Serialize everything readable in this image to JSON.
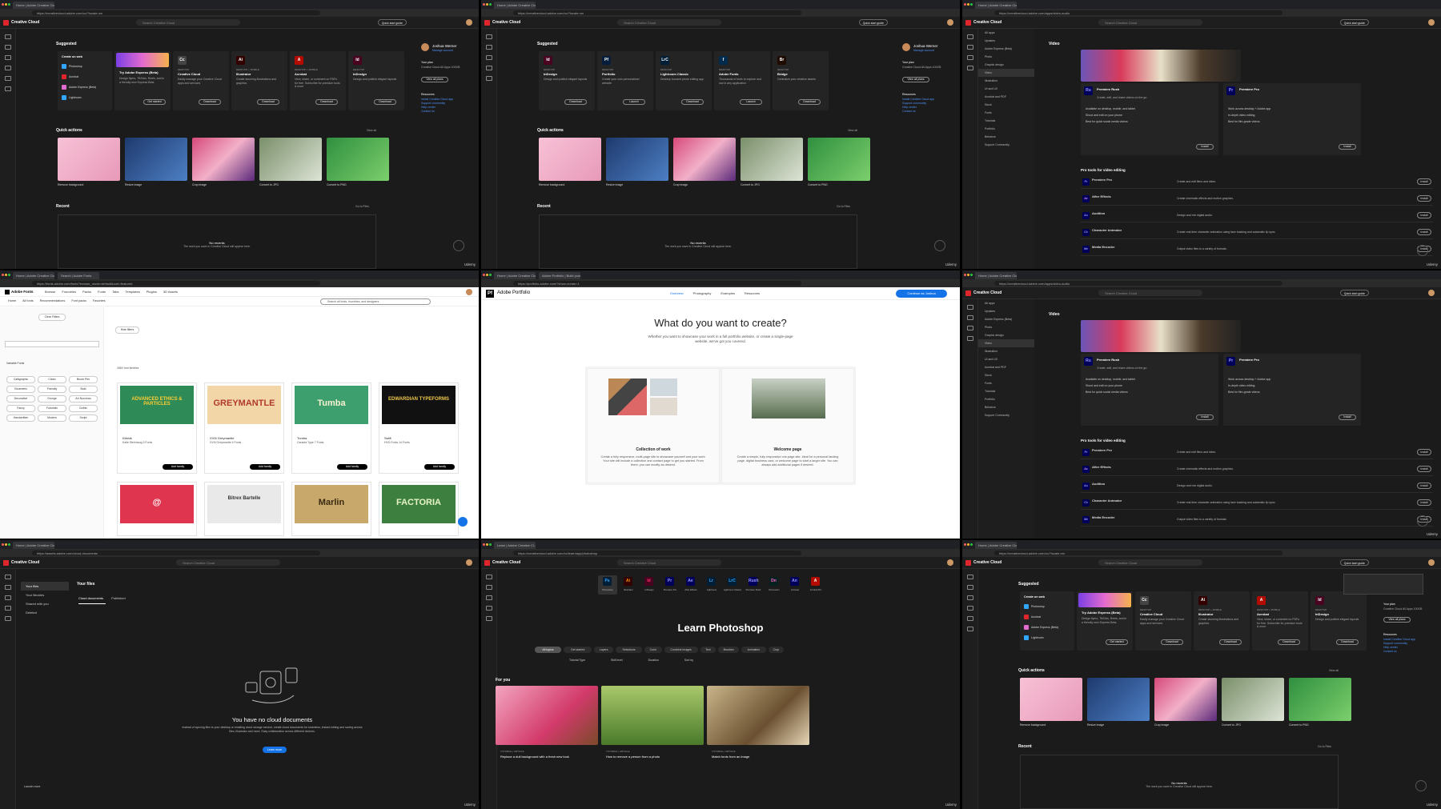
{
  "common": {
    "cc_title": "Creative Cloud",
    "search_placeholder": "Search Creative Cloud",
    "quick_start": "Quick start guide",
    "udemy": "Udemy",
    "tab_cc": "Home | Adobe Creative Cloud",
    "tab_fonts": "Search | Adobe Fonts",
    "tab_portfolio": "Adobe Portfolio | Build your",
    "tab_learn": "Learn | Adobe Creative Cl...",
    "url_home": "https://creativecloud.adobe.com/cc/?locale=en",
    "url_apps": "https://creativecloud.adobe.com/apps/video-audio",
    "url_fonts": "https://fonts.adobe.com/fonts?browse_mode=default&sort=featured",
    "url_portfolio": "https://portfolio.adobe.com/?show-create=1",
    "url_files": "https://assets.adobe.com/cloud-documents",
    "url_learn": "https://creativecloud.adobe.com/cc/learn/app/photoshop"
  },
  "home": {
    "suggested": "Suggested",
    "create_on_web": "Create on web",
    "web_items": [
      "Photoshop",
      "Acrobat",
      "Adobe Express (Beta)",
      "Lightroom"
    ],
    "express_title": "Try Adobe Express (Beta)",
    "express_desc": "Design flyers, TikToks, Reels, and in a friendly new Express Beta.",
    "get_started": "Get started",
    "apps": [
      {
        "tag": "DESKTOP",
        "name": "Creative Cloud",
        "desc": "Easily manage your Creative Cloud apps and services",
        "btn": "Download",
        "color": "#444",
        "abbr": "Cc"
      },
      {
        "tag": "DESKTOP + MOBILE",
        "name": "Illustrator",
        "desc": "Create stunning illustrations and graphics",
        "btn": "Download",
        "color": "#330000",
        "abbr": "Ai"
      },
      {
        "tag": "DESKTOP + MOBILE",
        "name": "Acrobat",
        "desc": "View, share, or comment on PDFs for free. Subscribe for premium tools & more",
        "btn": "Download",
        "color": "#b30b00",
        "abbr": "A"
      },
      {
        "tag": "DESKTOP",
        "name": "InDesign",
        "desc": "Design and publish elegant layouts",
        "btn": "Download",
        "color": "#49021f",
        "abbr": "Id"
      }
    ],
    "apps_b": [
      {
        "tag": "DESKTOP",
        "name": "InDesign",
        "desc": "Design and publish elegant layouts",
        "btn": "Download",
        "color": "#49021f",
        "abbr": "Id"
      },
      {
        "tag": "DESKTOP",
        "name": "Portfolio",
        "desc": "Create your own personalized website",
        "btn": "Launch",
        "color": "#061e3c",
        "abbr": "Pf"
      },
      {
        "tag": "DESKTOP",
        "name": "Lightroom Classic",
        "desc": "Desktop focused photo editing app",
        "btn": "Download",
        "color": "#001e36",
        "abbr": "LrC"
      },
      {
        "tag": "DESKTOP",
        "name": "Adobe Fonts",
        "desc": "Thousands of fonts to explore and use in any application",
        "btn": "Launch",
        "color": "#002b4d",
        "abbr": "f"
      },
      {
        "tag": "DESKTOP",
        "name": "Bridge",
        "desc": "Centralize your creative assets",
        "btn": "Download",
        "color": "#1f0b00",
        "abbr": "Br"
      }
    ],
    "user_name": "Joshua Werner",
    "manage_account": "Manage account",
    "your_plan": "Your plan",
    "plan_name": "Creative Cloud All Apps 100GB",
    "view_plans": "View all plans",
    "resources": "Resources",
    "resource_links": [
      "Install Creative Cloud app",
      "Support community",
      "Help center",
      "Contact us"
    ],
    "quick_actions": "Quick actions",
    "view_all": "View all",
    "actions": [
      "Remove background",
      "Resize image",
      "Crop image",
      "Convert to JPG",
      "Convert to PNG"
    ],
    "recent": "Recent",
    "go_to_files": "Go to Files",
    "no_recents": "No recents",
    "no_recents_desc": "The work you save in Creative Cloud will appear here."
  },
  "apps_page": {
    "heading": "Video",
    "sidebar": [
      "All apps",
      "Updates",
      "Adobe Express (Beta)",
      "Photo",
      "Graphic design",
      "Video",
      "Illustration",
      "UI and UX",
      "Acrobat and PDF",
      "Stock",
      "Fonts",
      "Tutorials",
      "Portfolio",
      "Behance",
      "Support Community"
    ],
    "rush_name": "Premiere Rush",
    "rush_desc": "Create, edit, and share videos on the go.",
    "rush_points": [
      "Available on desktop, mobile, and tablet",
      "Shoot and edit on your phone",
      "Best for quick social media videos"
    ],
    "pro_name": "Premiere Pro",
    "pro_points": [
      "Work across desktop + Adobe app",
      "In-depth video editing",
      "Best for film-grade videos"
    ],
    "install": "Install",
    "pro_tools": "Pro tools for video editing",
    "rows": [
      {
        "abbr": "Pr",
        "name": "Premiere Pro",
        "desc": "Create and edit films and video.",
        "color": "#00005b",
        "fg": "#9999ff"
      },
      {
        "abbr": "Ae",
        "name": "After Effects",
        "desc": "Create cinematic effects and motion graphics.",
        "color": "#00005b",
        "fg": "#d291ff"
      },
      {
        "abbr": "Au",
        "name": "Audition",
        "desc": "Design and mix digital audio.",
        "color": "#00005b",
        "fg": "#9999ff"
      },
      {
        "abbr": "Ch",
        "name": "Character Animator",
        "desc": "Create real-time character animation using face tracking and automatic lip sync.",
        "color": "#000050",
        "fg": "#9999ff"
      },
      {
        "abbr": "Me",
        "name": "Media Encoder",
        "desc": "Output video files to a variety of formats.",
        "color": "#00005b",
        "fg": "#9999ff"
      }
    ]
  },
  "fonts": {
    "brand": "Adobe Fonts",
    "nav": [
      "Browse",
      "Foundries",
      "Packs",
      "Fonts",
      "Tabs",
      "Templates",
      "Plugins",
      "3D Assets"
    ],
    "subnav": [
      "Home",
      "All fonts",
      "Recommendations",
      "Font packs",
      "Favorites"
    ],
    "search_placeholder": "Search all fonts, foundries, and designers",
    "clear_filters": "Clear Filters",
    "hide_filters": "Hide filters",
    "count": "2860 font families",
    "tags": [
      "Calligraphic",
      "Clean",
      "Brush Pen",
      "Geometric",
      "Friendly",
      "Bold",
      "Decorative",
      "Grunge",
      "Art Nouveau",
      "Fancy",
      "Futuristic",
      "Gothic",
      "Handwritten",
      "Modern",
      "Script"
    ],
    "variable": "Variable Fonts",
    "cards": [
      {
        "name": "Kitshik",
        "meta": "Kalle Steinhaug\n3 Fonts",
        "preview": "ADVANCED ETHICS & PARTICLES",
        "bg": "#2e8b57",
        "fg": "#ffcc33"
      },
      {
        "name": "XVIII Greymantle",
        "meta": "XVIII Greymantle\n4 Fonts",
        "preview": "GREYMANTLE",
        "bg": "#f3d6a8",
        "fg": "#b03a2e"
      },
      {
        "name": "Tumba",
        "meta": "Canada Type\n7 Fonts",
        "preview": "Tumba",
        "bg": "#3e9f6e",
        "fg": "#f5f0d0"
      },
      {
        "name": "Swift",
        "meta": "HVD Fonts\n14 Fonts",
        "preview": "EDWARDIAN TYPEFORMS",
        "bg": "#111",
        "fg": "#f0c84a"
      },
      {
        "name": "Tokumei",
        "meta": "Jakob Runge",
        "preview": "@",
        "bg": "#e0354f",
        "fg": "#fff"
      },
      {
        "name": "Bitrex Bartelle",
        "meta": "",
        "preview": "Bitrex Bartelle",
        "bg": "#e9e9e9",
        "fg": "#333"
      },
      {
        "name": "Marlin",
        "meta": "",
        "preview": "Marlin",
        "bg": "#c8a86b",
        "fg": "#3a2a10"
      },
      {
        "name": "Factoria",
        "meta": "",
        "preview": "FACTORIA",
        "bg": "#3d7f3f",
        "fg": "#e8f4c8"
      }
    ],
    "add_family": "Add family"
  },
  "portfolio": {
    "brand": "Adobe Portfolio",
    "nav": [
      "Overview",
      "Photography",
      "Examples",
      "Resources"
    ],
    "continue": "Continue as Joshua",
    "title": "What do you want to create?",
    "subtitle": "Whether you want to showcase your work in a full portfolio website, or create a single-page website, we've got you covered.",
    "options": [
      {
        "title": "Collection of work",
        "desc": "Create a fully responsive, multi-page site to showcase yourself and your work. Your site will include a collection and contact page to get you started. From there, you can modify as desired."
      },
      {
        "title": "Welcome page",
        "desc": "Create a simple, fully responsive one-page site. Ideal for a personal landing page, digital business card, or welcome page to start a larger site. You can always add additional pages if desired."
      }
    ]
  },
  "files": {
    "sidebar": [
      "Your files",
      "Your libraries",
      "Shared with you",
      "Deleted"
    ],
    "heading": "Your files",
    "tabs": [
      "Cloud documents",
      "Published"
    ],
    "empty_title": "You have no cloud documents",
    "empty_desc": "Instead of syncing files to your desktop or emailing cloud storage service, create cloud documents for seamless, instant editing and saving across files, Illustrator and more. Easy collaboration across different devices.",
    "learn_more": "Learn more",
    "launch_more": "Launch more"
  },
  "learn": {
    "apps": [
      {
        "abbr": "Ps",
        "label": "Photoshop",
        "color": "#001e36",
        "fg": "#31a8ff"
      },
      {
        "abbr": "Ai",
        "label": "Illustrator",
        "color": "#330000",
        "fg": "#ff9a00"
      },
      {
        "abbr": "Id",
        "label": "InDesign",
        "color": "#49021f",
        "fg": "#ff3366"
      },
      {
        "abbr": "Pr",
        "label": "Premiere Pro",
        "color": "#00005b",
        "fg": "#9999ff"
      },
      {
        "abbr": "Ae",
        "label": "After Effects",
        "color": "#00005b",
        "fg": "#9999ff"
      },
      {
        "abbr": "Lr",
        "label": "Lightroom",
        "color": "#001e36",
        "fg": "#31a8ff"
      },
      {
        "abbr": "LrC",
        "label": "Lightroom Classic",
        "color": "#001e36",
        "fg": "#31a8ff"
      },
      {
        "abbr": "Rush",
        "label": "Premiere Rush",
        "color": "#00005b",
        "fg": "#9999ff"
      },
      {
        "abbr": "Dn",
        "label": "Dimension",
        "color": "#062020",
        "fg": "#ff66cc"
      },
      {
        "abbr": "An",
        "label": "Animate",
        "color": "#00005b",
        "fg": "#9999ff"
      },
      {
        "abbr": "A",
        "label": "Acrobat DC",
        "color": "#b30b00",
        "fg": "#fff"
      }
    ],
    "title": "Learn Photoshop",
    "chips": [
      "All topics",
      "Get started",
      "Layers",
      "Selections",
      "Color",
      "Combine images",
      "Text",
      "Brushes",
      "Animation",
      "Crop"
    ],
    "filters": [
      "Tutorial Type",
      "Skill level",
      "Duration",
      "Sort by"
    ],
    "for_you": "For you",
    "items": [
      {
        "tag": "TUTORIAL | ARTICLE",
        "title": "Replace a dull background with a fresh new look"
      },
      {
        "tag": "TUTORIAL | ARTICLE",
        "title": "How to remove a person from a photo"
      },
      {
        "tag": "TUTORIAL | ARTICLE",
        "title": "Match fonts from an image"
      }
    ]
  }
}
